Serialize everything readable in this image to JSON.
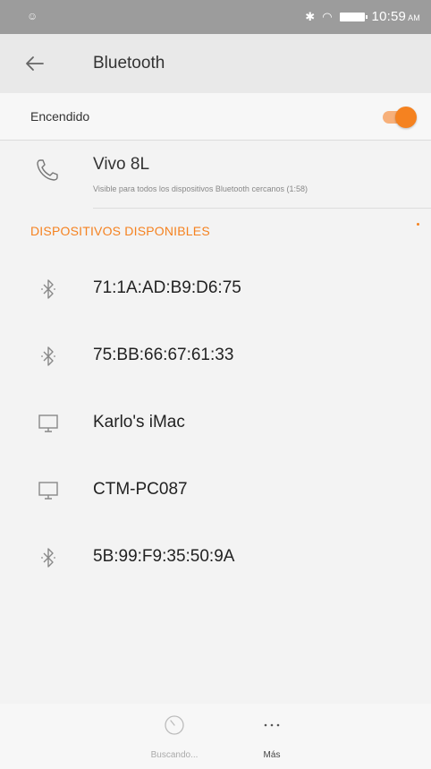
{
  "status_bar": {
    "time": "10:59",
    "ampm": "AM"
  },
  "header": {
    "title": "Bluetooth"
  },
  "toggle": {
    "label": "Encendido",
    "state": "on",
    "accent": "#f58220"
  },
  "this_device": {
    "name": "Vivo 8L",
    "subtitle": "Visible para todos los dispositivos Bluetooth cercanos (1:58)"
  },
  "section": {
    "title": "DISPOSITIVOS DISPONIBLES"
  },
  "devices": [
    {
      "label": "71:1A:AD:B9:D6:75",
      "icon": "bluetooth-icon"
    },
    {
      "label": "75:BB:66:67:61:33",
      "icon": "bluetooth-icon"
    },
    {
      "label": "Karlo's iMac",
      "icon": "computer-icon"
    },
    {
      "label": "CTM-PC087",
      "icon": "computer-icon"
    },
    {
      "label": "5B:99:F9:35:50:9A",
      "icon": "bluetooth-icon"
    }
  ],
  "bottom_actions": {
    "search_label": "Buscando...",
    "more_label": "Más"
  }
}
